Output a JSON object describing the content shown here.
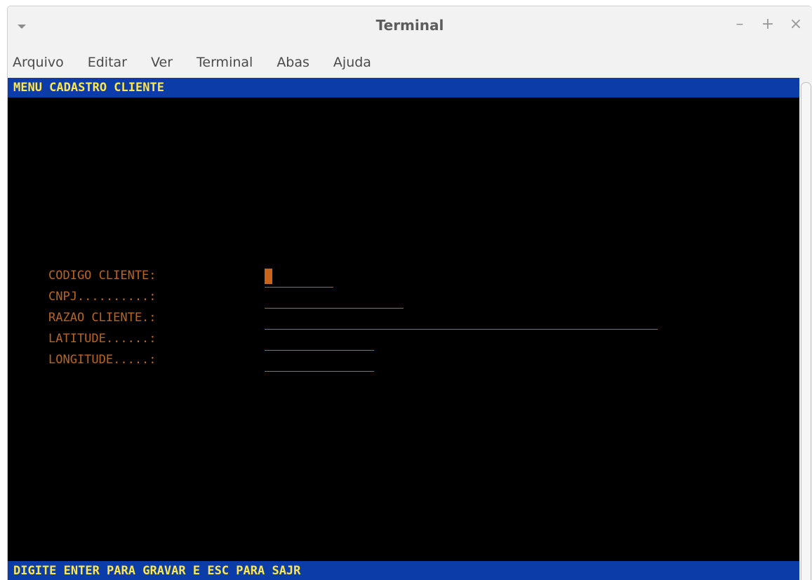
{
  "window": {
    "title": "Terminal",
    "controls": {
      "minimize": "–",
      "maximize": "+",
      "close": "×"
    }
  },
  "menubar": {
    "items": [
      "Arquivo",
      "Editar",
      "Ver",
      "Terminal",
      "Abas",
      "Ajuda"
    ]
  },
  "terminal": {
    "header": "MENU CADASTRO CLIENTE",
    "footer": "DIGITE ENTER PARA GRAVAR E ESC PARA SAJR",
    "fields": [
      {
        "label": "CODIGO CLIENTE:",
        "value": ""
      },
      {
        "label": "CNPJ..........:",
        "value": ""
      },
      {
        "label": "RAZAO CLIENTE.:",
        "value": ""
      },
      {
        "label": "LATITUDE......:",
        "value": ""
      },
      {
        "label": "LONGITUDE.....:",
        "value": ""
      }
    ]
  },
  "colors": {
    "bar_background": "#0b3ca8",
    "bar_text": "#ffe64d",
    "field_text": "#b8651d",
    "terminal_background": "#000000"
  }
}
